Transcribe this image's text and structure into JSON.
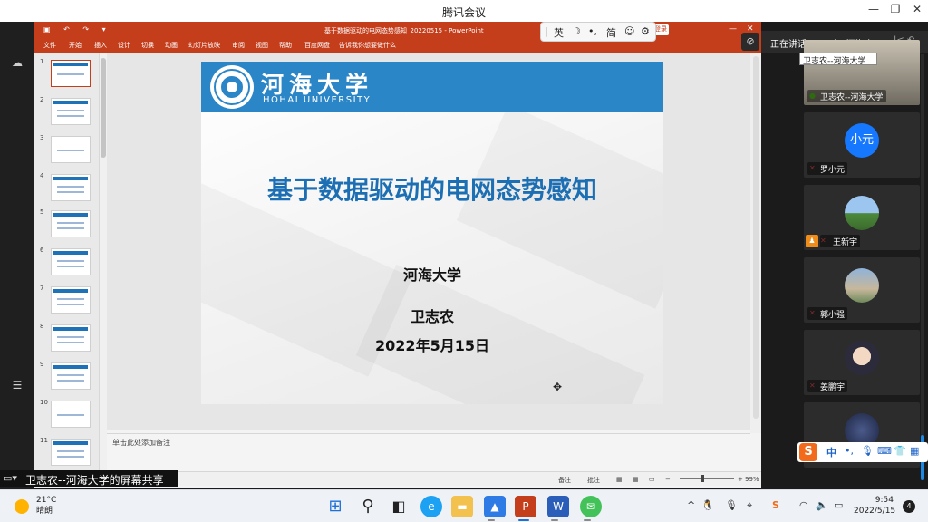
{
  "window": {
    "title": "腾讯会议",
    "min": "—",
    "max": "❐",
    "close": "✕"
  },
  "ppt": {
    "doc_title": "基于数据驱动的电网态势感知_20220515  -  PowerPoint",
    "login": "登录",
    "menu": [
      "文件",
      "开始",
      "插入",
      "设计",
      "切换",
      "动画",
      "幻灯片放映",
      "审阅",
      "视图",
      "帮助",
      "百度网盘",
      "告诉我你想要做什么"
    ],
    "thumb_numbers": [
      "1",
      "2",
      "3",
      "4",
      "5",
      "6",
      "7",
      "8",
      "9",
      "10",
      "11"
    ],
    "notes_placeholder": "单击此处添加备注",
    "status_notes": "备注",
    "status_comments": "批注",
    "zoom": "99%"
  },
  "slide": {
    "university_cn": "河海大学",
    "university_en": "HOHAI UNIVERSITY",
    "title": "基于数据驱动的电网态势感知",
    "org": "河海大学",
    "author": "卫志农",
    "date": "2022年5月15日"
  },
  "ime": {
    "lang": "英",
    "moon": "☽",
    "dot": "•,",
    "simplified": "简",
    "emoji": "☺",
    "settings": "⚙"
  },
  "meeting": {
    "speaking": "正在讲话: 卫志农--河海大...",
    "tooltip": "卫志农--河海大学",
    "share_banner": "卫志农--河海大学的屏幕共享",
    "participants": [
      {
        "name": "卫志农--河海大学",
        "avatar": "",
        "mic": "on"
      },
      {
        "name": "罗小元",
        "avatar": "小元",
        "mic": "off"
      },
      {
        "name": "王新宇",
        "avatar": "",
        "mic": "off"
      },
      {
        "name": "郭小强",
        "avatar": "",
        "mic": "off"
      },
      {
        "name": "姜鹏宇",
        "avatar": "",
        "mic": "off"
      },
      {
        "name": "",
        "avatar": "",
        "mic": "off"
      }
    ]
  },
  "sogou": {
    "logo": "S",
    "lang": "中",
    "punct": "•,"
  },
  "taskbar": {
    "temp": "21°C",
    "weather": "晴朗",
    "time": "9:54",
    "date": "2022/5/15",
    "notifications": "4",
    "tray_arrow": "^"
  },
  "colors": {
    "ppt_brand": "#c43e1c",
    "slide_blue": "#2b86c8",
    "title_blue": "#1d6fb4"
  }
}
